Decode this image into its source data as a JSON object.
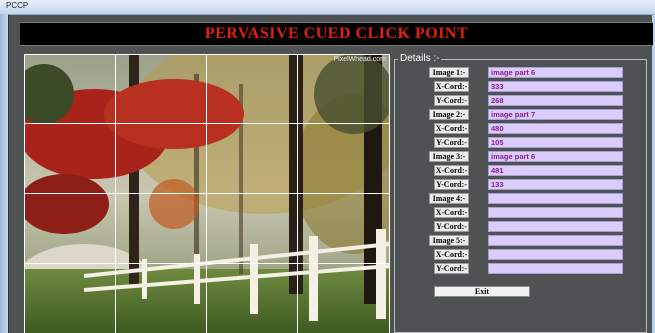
{
  "window": {
    "title": "PCCP"
  },
  "banner": {
    "title": "PERVASIVE CUED CLICK POINT"
  },
  "image": {
    "watermark": "PixelWhead.com"
  },
  "details": {
    "legend": "Details :-",
    "entries": [
      {
        "image_label": "Image 1:-",
        "image_value": "image part 6",
        "x_label": "X-Cord:-",
        "x_value": "333",
        "y_label": "Y-Cord:-",
        "y_value": "268"
      },
      {
        "image_label": "Image 2:-",
        "image_value": "image part 7",
        "x_label": "X-Cord:-",
        "x_value": "480",
        "y_label": "Y-Cord:-",
        "y_value": "105"
      },
      {
        "image_label": "Image 3:-",
        "image_value": "image part 6",
        "x_label": "X-Cord:-",
        "x_value": "481",
        "y_label": "Y-Cord:-",
        "y_value": "133"
      },
      {
        "image_label": "Image 4:-",
        "image_value": "",
        "x_label": "X-Cord:-",
        "x_value": "",
        "y_label": "Y-Cord:-",
        "y_value": ""
      },
      {
        "image_label": "Image 5:-",
        "image_value": "",
        "x_label": "X-Cord:-",
        "x_value": "",
        "y_label": "Y-Cord:-",
        "y_value": ""
      }
    ]
  },
  "exit_button": {
    "label": "Exit"
  }
}
